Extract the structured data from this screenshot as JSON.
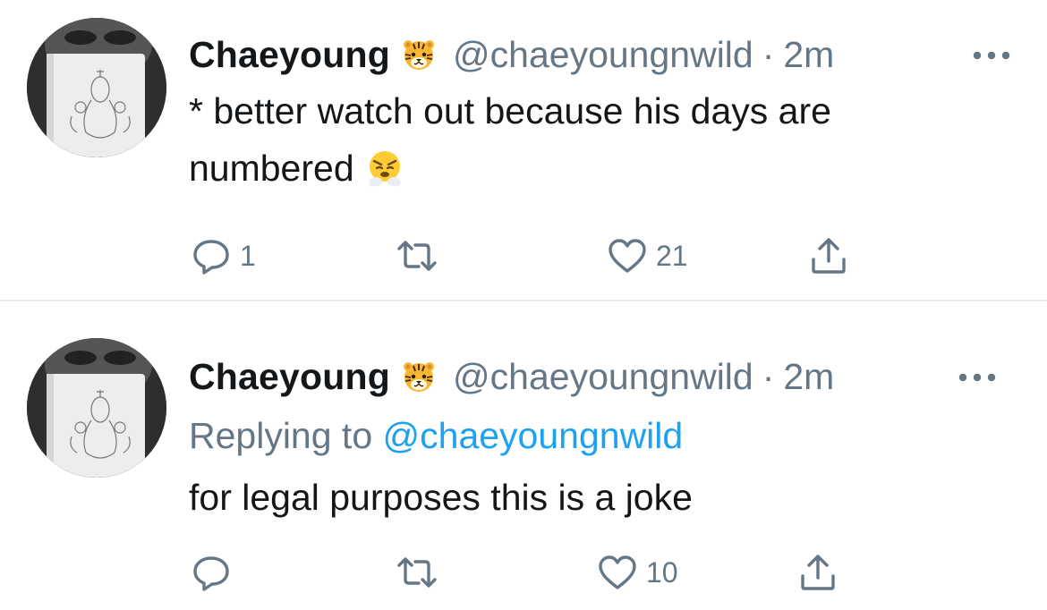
{
  "colors": {
    "text": "#14171a",
    "muted": "#657786",
    "link": "#1da1f2",
    "divider": "#e6ecf0"
  },
  "tweets": [
    {
      "display_name": "Chaeyoung",
      "badge_emoji": "tiger-face-emoji",
      "handle": "@chaeyoungnwild",
      "separator": "·",
      "time": "2m",
      "text": "* better watch out because his days are numbered",
      "text_emoji": "face-with-steam-from-nose-emoji",
      "reply_count": "1",
      "retweet_count": "",
      "like_count": "21"
    },
    {
      "display_name": "Chaeyoung",
      "badge_emoji": "tiger-face-emoji",
      "handle": "@chaeyoungnwild",
      "separator": "·",
      "time": "2m",
      "replying_prefix": "Replying to",
      "replying_to": "@chaeyoungnwild",
      "text": "for legal purposes this is a joke",
      "reply_count": "",
      "retweet_count": "",
      "like_count": "10"
    }
  ]
}
